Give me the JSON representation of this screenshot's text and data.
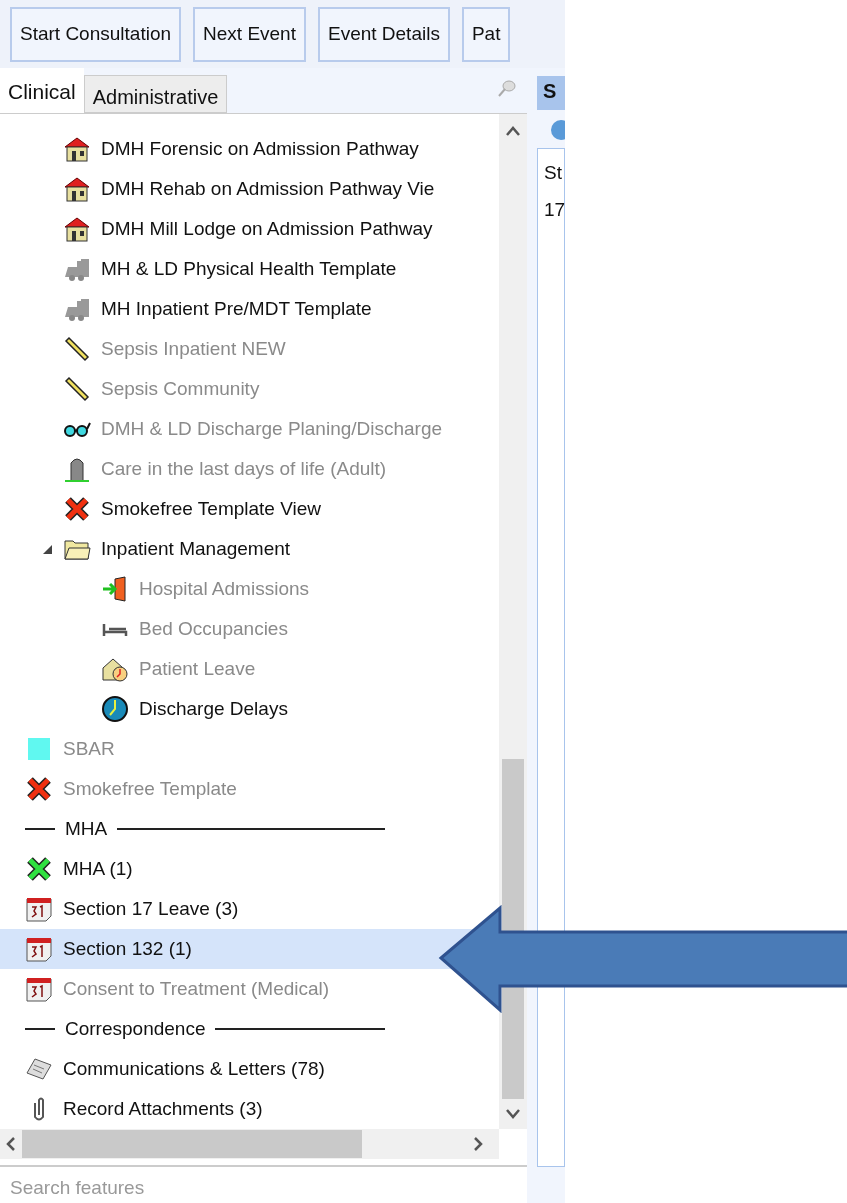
{
  "toolbar": {
    "buttons": [
      "Start Consultation",
      "Next Event",
      "Event Details",
      "Pat"
    ]
  },
  "tabs": [
    {
      "label": "Clinical",
      "selected": true
    },
    {
      "label": "Administrative",
      "selected": false
    }
  ],
  "tree": {
    "continued_children": [
      {
        "kind": "house",
        "label": "DMH Forensic on Admission Pathway",
        "disabled": false,
        "selected": false
      },
      {
        "kind": "house",
        "label": "DMH Rehab on Admission Pathway Vie",
        "disabled": false,
        "selected": false
      },
      {
        "kind": "house",
        "label": "DMH Mill Lodge on Admission Pathway",
        "disabled": false,
        "selected": false
      },
      {
        "kind": "train",
        "label": "MH & LD Physical Health Template",
        "disabled": false,
        "selected": false
      },
      {
        "kind": "train",
        "label": "MH Inpatient Pre/MDT Template",
        "disabled": false,
        "selected": false
      },
      {
        "kind": "ruler",
        "label": "Sepsis Inpatient NEW",
        "disabled": true,
        "selected": false
      },
      {
        "kind": "ruler",
        "label": "Sepsis Community",
        "disabled": true,
        "selected": false
      },
      {
        "kind": "glasses",
        "label": "DMH & LD Discharge Planing/Discharge",
        "disabled": true,
        "selected": false
      },
      {
        "kind": "headstone",
        "label": "Care in the last days of life (Adult)",
        "disabled": true,
        "selected": false
      },
      {
        "kind": "red-cross",
        "label": "Smokefree Template View",
        "disabled": false,
        "selected": false
      },
      {
        "kind": "folder",
        "label": "Inpatient Management",
        "disabled": false,
        "selected": false,
        "expanded": true,
        "children": [
          {
            "kind": "door",
            "label": "Hospital Admissions",
            "disabled": true,
            "selected": false
          },
          {
            "kind": "bed",
            "label": "Bed Occupancies",
            "disabled": true,
            "selected": false
          },
          {
            "kind": "leave",
            "label": "Patient Leave",
            "disabled": true,
            "selected": false
          },
          {
            "kind": "clock",
            "label": "Discharge Delays",
            "disabled": false,
            "selected": false
          }
        ]
      }
    ],
    "items": [
      {
        "kind": "square",
        "label": "SBAR",
        "disabled": true,
        "selected": false
      },
      {
        "kind": "red-cross",
        "label": "Smokefree Template",
        "disabled": true,
        "selected": false
      },
      {
        "kind": "separator",
        "label": "MHA"
      },
      {
        "kind": "green-cross",
        "label": "MHA (1)",
        "disabled": false,
        "selected": false
      },
      {
        "kind": "calendar",
        "label": "Section 17 Leave (3)",
        "disabled": false,
        "selected": false
      },
      {
        "kind": "calendar",
        "label": "Section 132 (1)",
        "disabled": false,
        "selected": true
      },
      {
        "kind": "calendar",
        "label": "Consent to Treatment (Medical)",
        "disabled": true,
        "selected": false
      },
      {
        "kind": "separator",
        "label": "Correspondence"
      },
      {
        "kind": "letters",
        "label": "Communications & Letters (78)",
        "disabled": false,
        "selected": false
      },
      {
        "kind": "paperclip",
        "label": "Record Attachments (3)",
        "disabled": false,
        "selected": false
      }
    ]
  },
  "search": {
    "placeholder": "Search features"
  },
  "side_panel": {
    "header": "S",
    "column_1": "St",
    "cell_1": "17"
  }
}
